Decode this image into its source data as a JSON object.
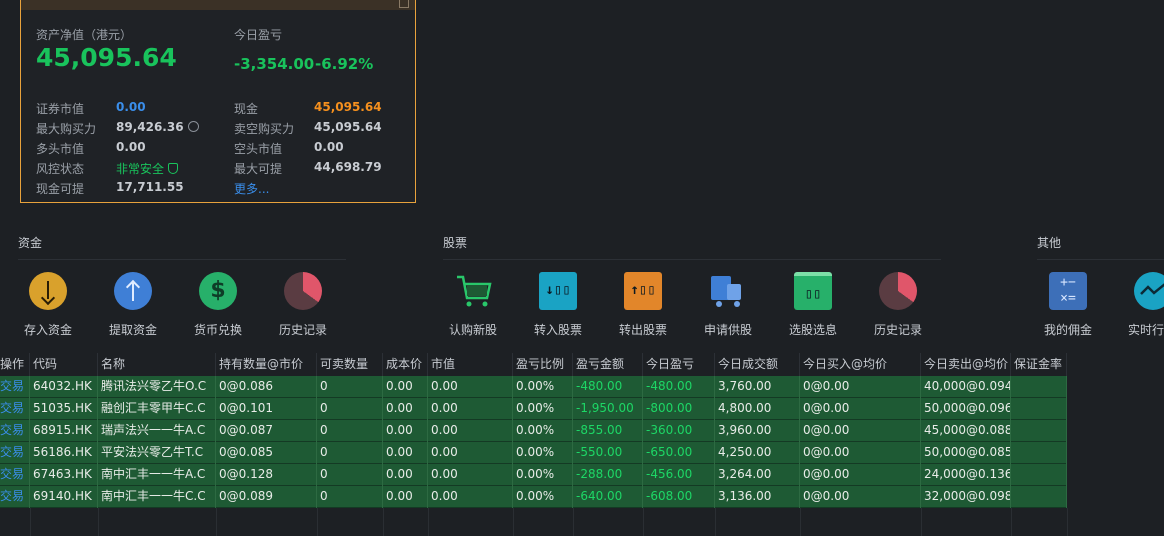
{
  "account": {
    "net_assets_label": "资产净值（港元）",
    "net_assets_value": "45,095.64",
    "today_pnl_label": "今日盈亏",
    "today_pnl_value": "-3,354.00",
    "today_pnl_pct": "-6.92%",
    "fields": {
      "securities_value_label": "证券市值",
      "securities_value": "0.00",
      "cash_label": "现金",
      "cash": "45,095.64",
      "max_buying_power_label": "最大购买力",
      "max_buying_power": "89,426.36",
      "short_buying_power_label": "卖空购买力",
      "short_buying_power": "45,095.64",
      "long_value_label": "多头市值",
      "long_value": "0.00",
      "short_value_label": "空头市值",
      "short_value": "0.00",
      "risk_status_label": "风控状态",
      "risk_status": "非常安全",
      "max_withdraw_label": "最大可提",
      "max_withdraw": "44,698.79",
      "cash_withdraw_label": "现金可提",
      "cash_withdraw": "17,711.55",
      "more_link": "更多..."
    }
  },
  "sections": {
    "funds": {
      "title": "资金",
      "tools": [
        {
          "label": "存入资金",
          "icon": "deposit-icon"
        },
        {
          "label": "提取资金",
          "icon": "withdraw-icon"
        },
        {
          "label": "货币兑换",
          "icon": "currency-exchange-icon"
        },
        {
          "label": "历史记录",
          "icon": "history-icon"
        }
      ]
    },
    "stocks": {
      "title": "股票",
      "tools": [
        {
          "label": "认购新股",
          "icon": "ipo-cart-icon"
        },
        {
          "label": "转入股票",
          "icon": "transfer-in-icon"
        },
        {
          "label": "转出股票",
          "icon": "transfer-out-icon"
        },
        {
          "label": "申请供股",
          "icon": "rights-issue-icon"
        },
        {
          "label": "选股选息",
          "icon": "scrip-dividend-icon"
        },
        {
          "label": "历史记录",
          "icon": "history-icon"
        }
      ]
    },
    "other": {
      "title": "其他",
      "tools": [
        {
          "label": "我的佣金",
          "icon": "calculator-icon"
        },
        {
          "label": "实时行",
          "icon": "realtime-quote-icon"
        }
      ]
    }
  },
  "table": {
    "headers": [
      "操作",
      "代码",
      "名称",
      "持有数量@市价",
      "可卖数量",
      "成本价",
      "市值",
      "盈亏比例",
      "盈亏金额",
      "今日盈亏",
      "今日成交额",
      "今日买入@均价",
      "今日卖出@均价",
      "保证金率"
    ],
    "rows": [
      [
        "交易",
        "64032.HK",
        "腾讯法兴零乙牛O.C",
        "0@0.086",
        "0",
        "0.00",
        "0.00",
        "0.00%",
        "-480.00",
        "-480.00",
        "3,760.00",
        "0@0.00",
        "40,000@0.094",
        ""
      ],
      [
        "交易",
        "51035.HK",
        "融创汇丰零甲牛C.C",
        "0@0.101",
        "0",
        "0.00",
        "0.00",
        "0.00%",
        "-1,950.00",
        "-800.00",
        "4,800.00",
        "0@0.00",
        "50,000@0.096",
        ""
      ],
      [
        "交易",
        "68915.HK",
        "瑞声法兴一一牛A.C",
        "0@0.087",
        "0",
        "0.00",
        "0.00",
        "0.00%",
        "-855.00",
        "-360.00",
        "3,960.00",
        "0@0.00",
        "45,000@0.088",
        ""
      ],
      [
        "交易",
        "56186.HK",
        "平安法兴零乙牛T.C",
        "0@0.085",
        "0",
        "0.00",
        "0.00",
        "0.00%",
        "-550.00",
        "-650.00",
        "4,250.00",
        "0@0.00",
        "50,000@0.085",
        ""
      ],
      [
        "交易",
        "67463.HK",
        "南中汇丰一一牛A.C",
        "0@0.128",
        "0",
        "0.00",
        "0.00",
        "0.00%",
        "-288.00",
        "-456.00",
        "3,264.00",
        "0@0.00",
        "24,000@0.136",
        ""
      ],
      [
        "交易",
        "69140.HK",
        "南中汇丰一一牛C.C",
        "0@0.089",
        "0",
        "0.00",
        "0.00",
        "0.00%",
        "-640.00",
        "-608.00",
        "3,136.00",
        "0@0.00",
        "32,000@0.098",
        ""
      ]
    ]
  },
  "colors": {
    "accent_orange": "#f5901e",
    "profit_green": "#19c35c",
    "link_blue": "#3a8eea",
    "row_green": "#1e5a34"
  }
}
